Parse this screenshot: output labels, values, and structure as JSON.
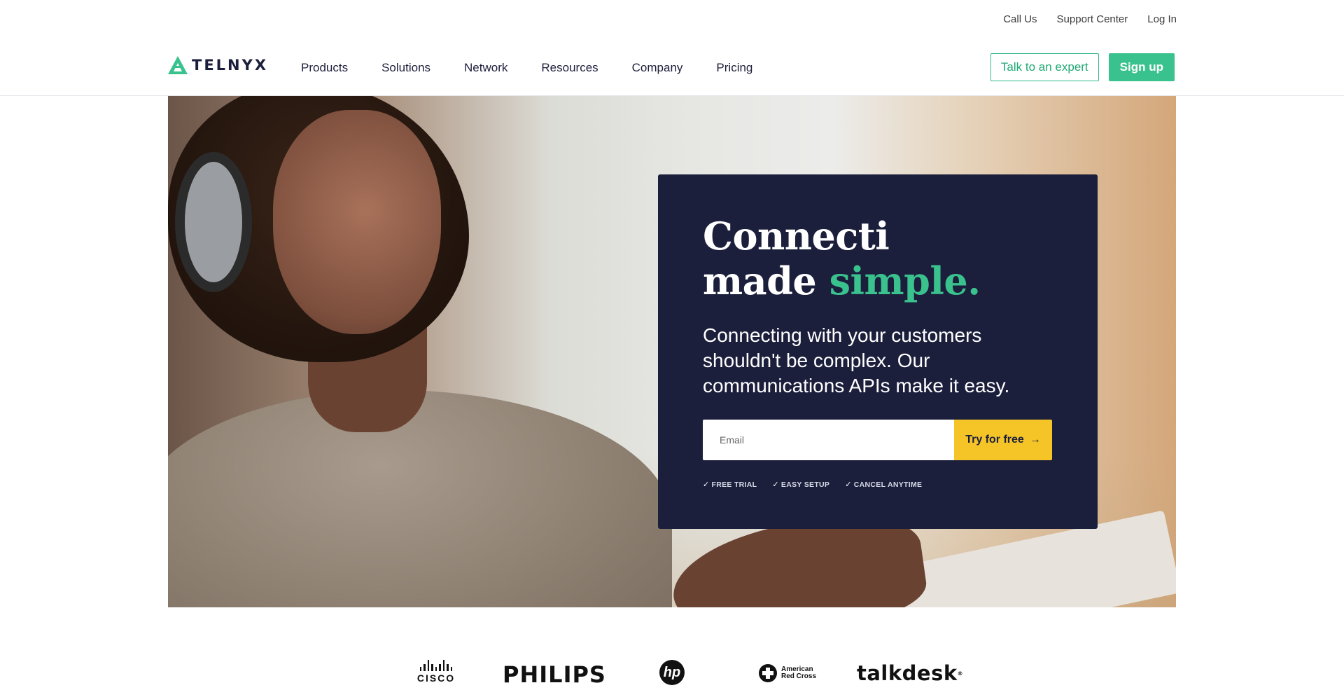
{
  "utility_nav": {
    "call_us": "Call Us",
    "support_center": "Support Center",
    "log_in": "Log In"
  },
  "brand": {
    "name": "TELNYX",
    "accent_color": "#3ac28e",
    "navy_color": "#1c1f3c",
    "cta_color": "#f5c527"
  },
  "nav": {
    "items": [
      "Products",
      "Solutions",
      "Network",
      "Resources",
      "Company",
      "Pricing"
    ]
  },
  "header_actions": {
    "talk_expert": "Talk to an expert",
    "sign_up": "Sign up"
  },
  "hero": {
    "title_line1": "Connecti",
    "title_line2_plain": "made",
    "title_line2_accent": "simple.",
    "subtitle": "Connecting with your customers shouldn't be complex. Our communications APIs make it easy.",
    "email_placeholder": "Email",
    "try_button": "Try for free",
    "features": [
      "FREE TRIAL",
      "EASY SETUP",
      "CANCEL ANYTIME"
    ]
  },
  "customer_logos": {
    "cisco": "CISCO",
    "philips": "PHILIPS",
    "hp": "hp",
    "red_cross_line1": "American",
    "red_cross_line2": "Red Cross",
    "talkdesk": "talkdesk"
  }
}
